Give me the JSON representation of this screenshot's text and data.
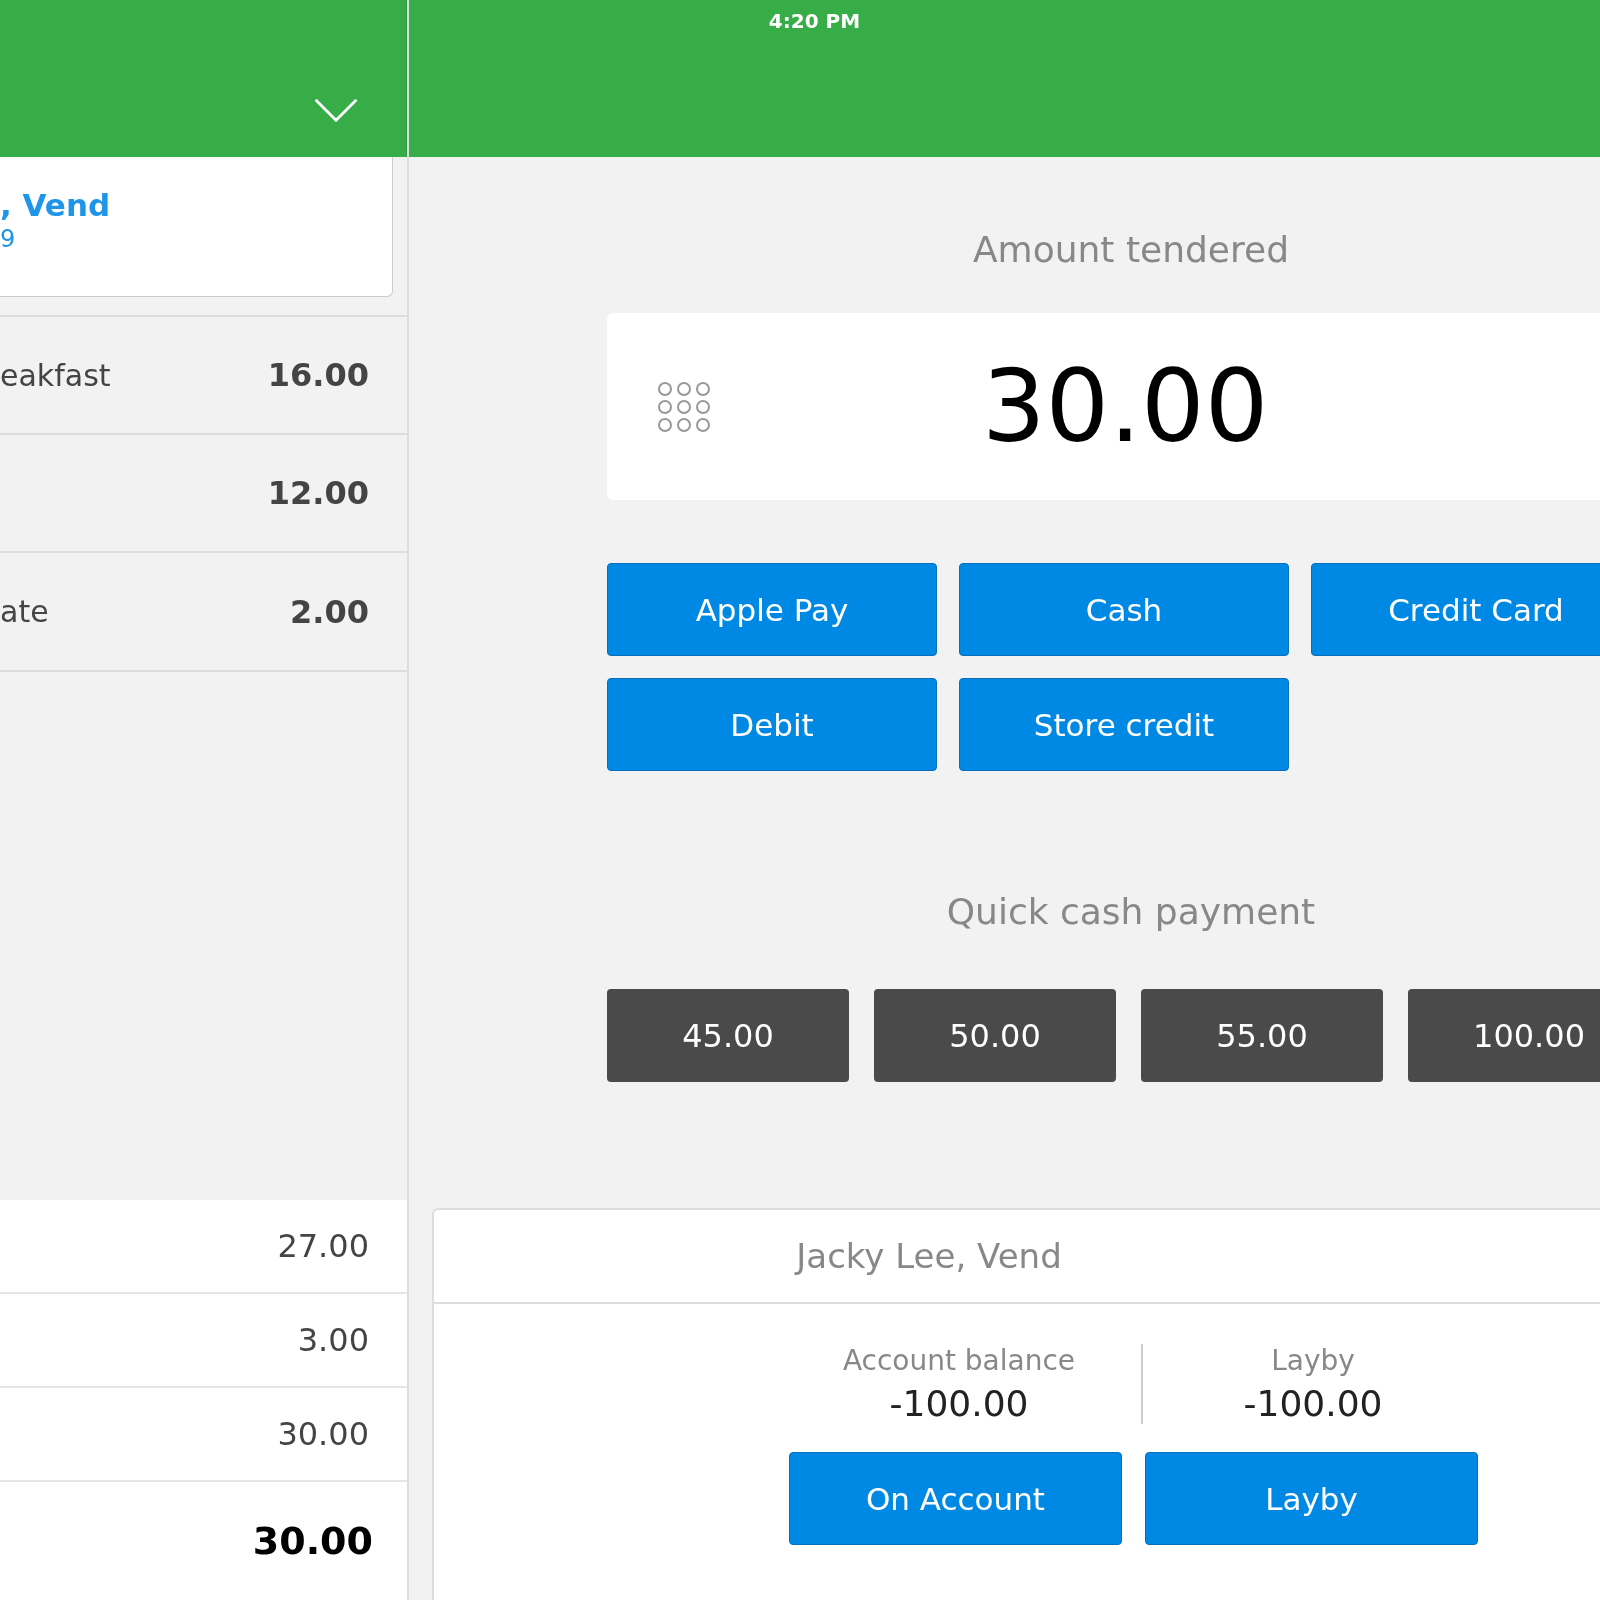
{
  "status_bar": {
    "time": "4:20 PM"
  },
  "sale_panel": {
    "customer": {
      "name": ", Vend",
      "detail": "9"
    },
    "line_items": [
      {
        "name": "eakfast",
        "price": "16.00"
      },
      {
        "price": "12.00"
      },
      {
        "name": "ate",
        "price": "2.00"
      }
    ],
    "totals": [
      {
        "value": "27.00",
        "kind": "normal"
      },
      {
        "value": "3.00",
        "kind": "normal"
      },
      {
        "value": "30.00",
        "kind": "normal"
      },
      {
        "value": "30.00",
        "kind": "total"
      }
    ]
  },
  "payment": {
    "title": "Amount tendered",
    "amount": "30.00",
    "methods": [
      "Apple Pay",
      "Cash",
      "Credit Card",
      "Debit",
      "Store credit"
    ],
    "quick_cash_title": "Quick cash payment",
    "quick_cash": [
      "45.00",
      "50.00",
      "55.00",
      "100.00"
    ]
  },
  "customer_card": {
    "name": "Jacky Lee, Vend",
    "stats": [
      {
        "label": "Account balance",
        "value": "-100.00"
      },
      {
        "label": "Layby",
        "value": "-100.00"
      }
    ],
    "buttons": [
      "On Account",
      "Layby"
    ]
  }
}
